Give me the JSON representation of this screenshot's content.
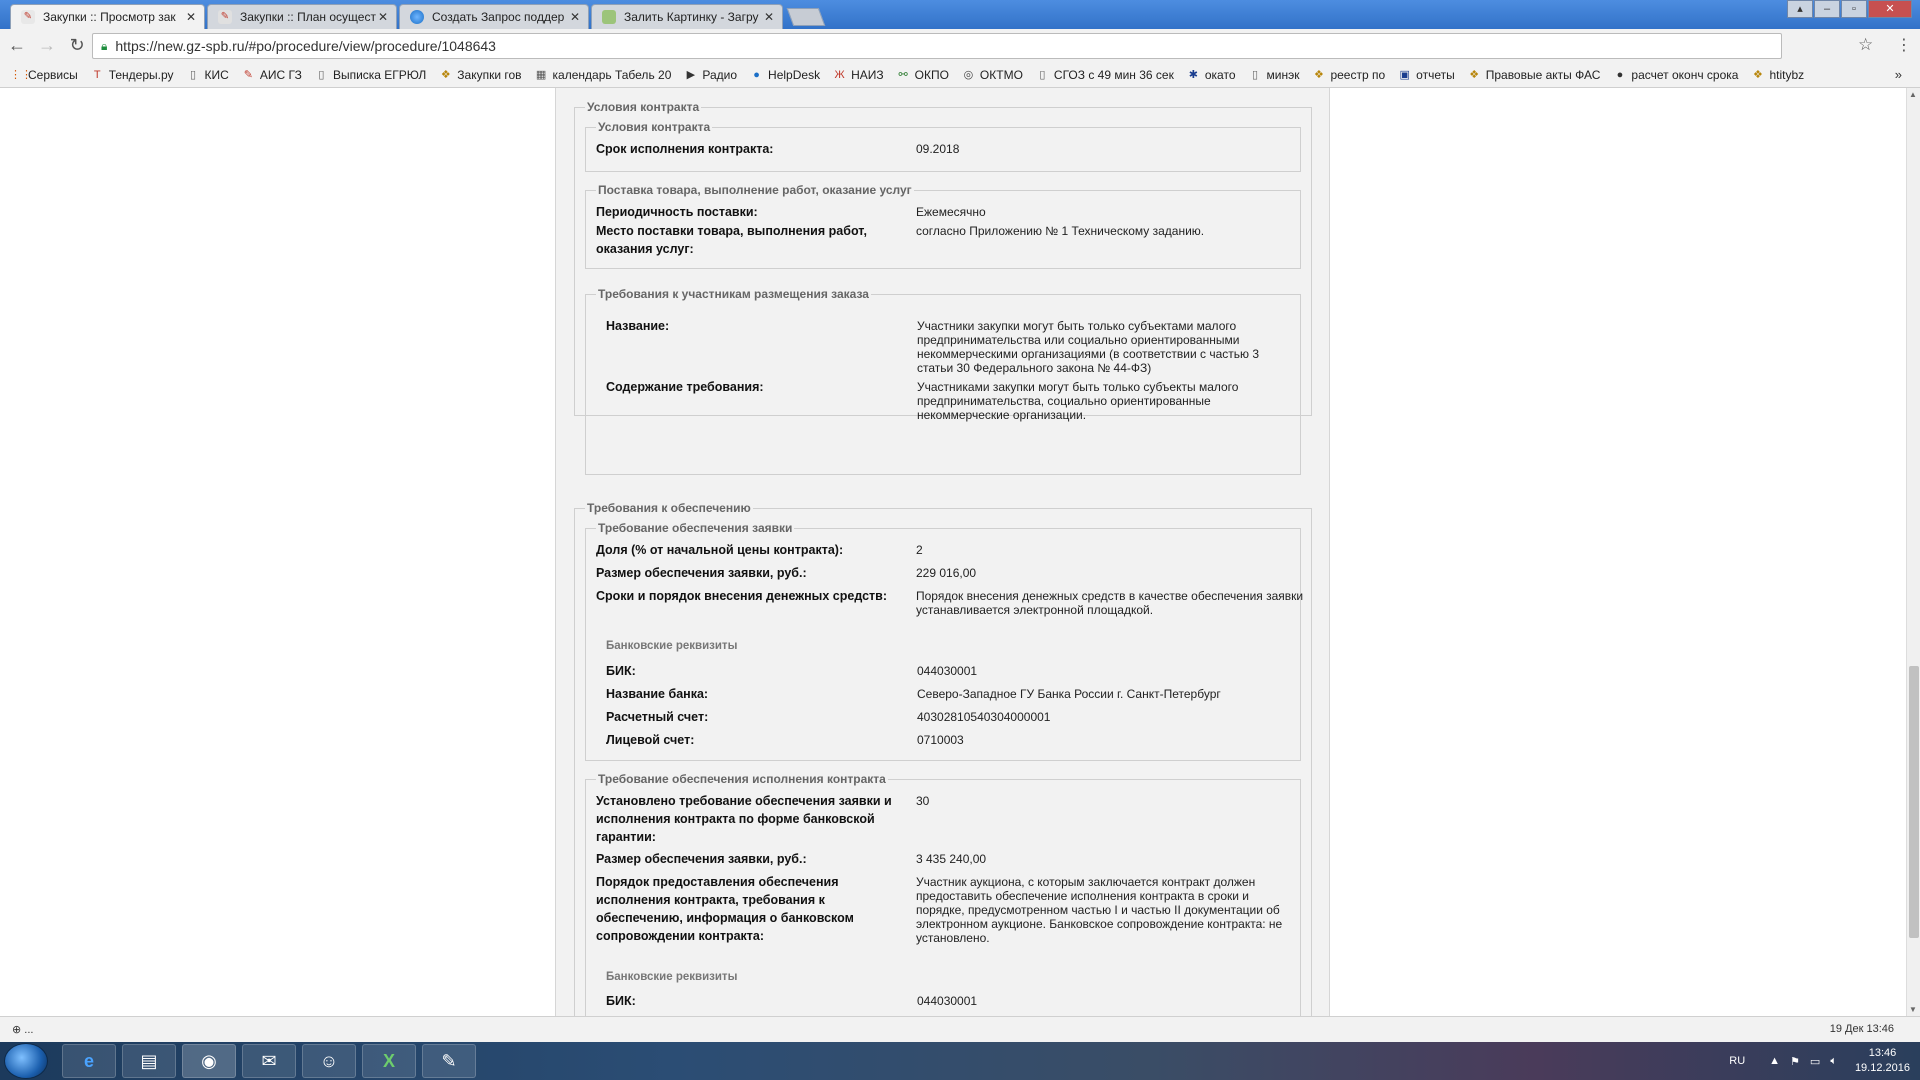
{
  "tabs": [
    {
      "title": "Закупки :: Просмотр зак",
      "active": true,
      "icon": "gz-icon"
    },
    {
      "title": "Закупки :: План осущест",
      "active": false,
      "icon": "gz-icon"
    },
    {
      "title": "Создать Запрос поддер",
      "active": false,
      "icon": "globe-icon"
    },
    {
      "title": "Залить Картинку - Загру",
      "active": false,
      "icon": "image-icon"
    }
  ],
  "address": {
    "url": "https://new.gz-spb.ru/#po/procedure/view/procedure/1048643"
  },
  "bookmarks": [
    {
      "label": "Сервисы",
      "icon": "apps-icon"
    },
    {
      "label": "Тендеры.ру",
      "icon": "tenders-icon"
    },
    {
      "label": "КИС",
      "icon": "page-icon"
    },
    {
      "label": "АИС ГЗ",
      "icon": "gz-icon"
    },
    {
      "label": "Выписка ЕГРЮЛ",
      "icon": "page-icon"
    },
    {
      "label": "Закупки гов",
      "icon": "emblem-icon"
    },
    {
      "label": "календарь Табель 20",
      "icon": "calendar-icon"
    },
    {
      "label": "Радио",
      "icon": "play-icon"
    },
    {
      "label": "HelpDesk",
      "icon": "globe-icon"
    },
    {
      "label": "НАИЗ",
      "icon": "naiz-icon"
    },
    {
      "label": "ОКПО",
      "icon": "share-icon"
    },
    {
      "label": "ОКТМО",
      "icon": "circle-icon"
    },
    {
      "label": "СГОЗ с 49 мин 36 сек",
      "icon": "page-icon"
    },
    {
      "label": "окато",
      "icon": "snow-icon"
    },
    {
      "label": "минэк",
      "icon": "page-icon"
    },
    {
      "label": "реестр по",
      "icon": "emblem-icon"
    },
    {
      "label": "отчеты",
      "icon": "report-icon"
    },
    {
      "label": "Правовые акты ФАС",
      "icon": "emblem-icon"
    },
    {
      "label": "расчет оконч срока",
      "icon": "globe-dark-icon"
    },
    {
      "label": "htitybz",
      "icon": "emblem-icon"
    }
  ],
  "contract_terms": {
    "legend": "Условия контракта",
    "inner_legend": "Условия контракта",
    "term_label": "Срок исполнения контракта:",
    "term_value": "09.2018"
  },
  "delivery": {
    "legend": "Поставка товара, выполнение работ, оказание услуг",
    "periodicity_label": "Периодичность поставки:",
    "periodicity_value": "Ежемесячно",
    "place_label_1": "Место поставки товара, выполнения работ,",
    "place_label_2": "оказания услуг:",
    "place_value": "согласно Приложению № 1 Техническому заданию."
  },
  "participant_requirements": {
    "legend": "Требования к участникам размещения заказа",
    "name_label": "Название:",
    "name_value_lines": [
      "Участники закупки могут быть только субъектами малого",
      "предпринимательства или социально ориентированными",
      "некоммерческими организациями (в соответствии с частью 3",
      "статьи 30 Федерального закона № 44-ФЗ)"
    ],
    "content_label": "Содержание требования:",
    "content_value_lines": [
      "Участниками закупки могут быть только субъекты малого",
      "предпринимательства, социально ориентированные",
      "некоммерческие организации."
    ]
  },
  "security": {
    "legend": "Требования к обеспечению",
    "bid": {
      "legend": "Требование обеспечения заявки",
      "share_label": "Доля (% от начальной цены контракта):",
      "share_value": "2",
      "amount_label": "Размер обеспечения заявки, руб.:",
      "amount_value": "229 016,00",
      "terms_label": "Сроки и порядок внесения денежных средств:",
      "terms_value_lines": [
        "Порядок внесения денежных средств в качестве обеспечения заявки",
        "устанавливается электронной площадкой."
      ],
      "bank_legend": "Банковские реквизиты",
      "bik_label": "БИК:",
      "bik_value": "044030001",
      "bank_name_label": "Название банка:",
      "bank_name_value": "Северо-Западное ГУ Банка России г. Санкт-Петербург",
      "account_label": "Расчетный счет:",
      "account_value": "40302810540304000001",
      "personal_label": "Лицевой счет:",
      "personal_value": "0710003"
    },
    "contract": {
      "legend": "Требование обеспечения исполнения контракта",
      "guarantee_label_lines": [
        "Установлено требование обеспечения заявки и",
        "исполнения контракта по форме банковской",
        "гарантии:"
      ],
      "guarantee_value": "30",
      "amount_label": "Размер обеспечения заявки, руб.:",
      "amount_value": "3 435 240,00",
      "order_label_lines": [
        "Порядок предоставления обеспечения",
        "исполнения контракта, требования к",
        "обеспечению, информация о банковском",
        "сопровождении контракта:"
      ],
      "order_value_lines": [
        "Участник аукциона, с которым заключается контракт должен",
        "предоставить обеспечение исполнения контракта в сроки и",
        "порядке, предусмотренном частью I и частью II документации об",
        "электронном аукционе. Банковское сопровождение контракта: не",
        "установлено."
      ],
      "bank_legend": "Банковские реквизиты",
      "bik_label": "БИК:",
      "bik_value": "044030001"
    }
  },
  "status": {
    "left": "...",
    "right": "19 Дек 13:46"
  },
  "taskbar": {
    "lang": "RU",
    "time": "13:46",
    "date": "19.12.2016",
    "apps": [
      "ie-icon",
      "explorer-icon",
      "chrome-icon",
      "outlook-icon",
      "user-icon",
      "excel-icon",
      "paint-icon"
    ]
  }
}
